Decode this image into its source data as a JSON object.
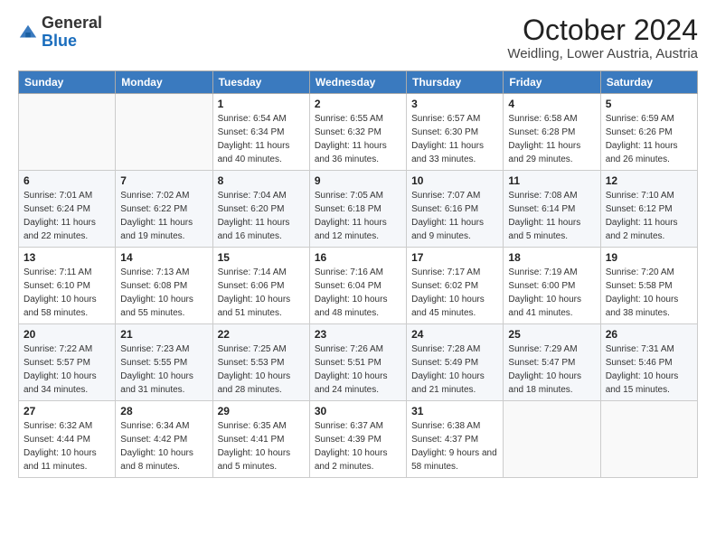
{
  "logo": {
    "general": "General",
    "blue": "Blue"
  },
  "header": {
    "month": "October 2024",
    "location": "Weidling, Lower Austria, Austria"
  },
  "weekdays": [
    "Sunday",
    "Monday",
    "Tuesday",
    "Wednesday",
    "Thursday",
    "Friday",
    "Saturday"
  ],
  "weeks": [
    [
      {
        "day": "",
        "sunrise": "",
        "sunset": "",
        "daylight": ""
      },
      {
        "day": "",
        "sunrise": "",
        "sunset": "",
        "daylight": ""
      },
      {
        "day": "1",
        "sunrise": "Sunrise: 6:54 AM",
        "sunset": "Sunset: 6:34 PM",
        "daylight": "Daylight: 11 hours and 40 minutes."
      },
      {
        "day": "2",
        "sunrise": "Sunrise: 6:55 AM",
        "sunset": "Sunset: 6:32 PM",
        "daylight": "Daylight: 11 hours and 36 minutes."
      },
      {
        "day": "3",
        "sunrise": "Sunrise: 6:57 AM",
        "sunset": "Sunset: 6:30 PM",
        "daylight": "Daylight: 11 hours and 33 minutes."
      },
      {
        "day": "4",
        "sunrise": "Sunrise: 6:58 AM",
        "sunset": "Sunset: 6:28 PM",
        "daylight": "Daylight: 11 hours and 29 minutes."
      },
      {
        "day": "5",
        "sunrise": "Sunrise: 6:59 AM",
        "sunset": "Sunset: 6:26 PM",
        "daylight": "Daylight: 11 hours and 26 minutes."
      }
    ],
    [
      {
        "day": "6",
        "sunrise": "Sunrise: 7:01 AM",
        "sunset": "Sunset: 6:24 PM",
        "daylight": "Daylight: 11 hours and 22 minutes."
      },
      {
        "day": "7",
        "sunrise": "Sunrise: 7:02 AM",
        "sunset": "Sunset: 6:22 PM",
        "daylight": "Daylight: 11 hours and 19 minutes."
      },
      {
        "day": "8",
        "sunrise": "Sunrise: 7:04 AM",
        "sunset": "Sunset: 6:20 PM",
        "daylight": "Daylight: 11 hours and 16 minutes."
      },
      {
        "day": "9",
        "sunrise": "Sunrise: 7:05 AM",
        "sunset": "Sunset: 6:18 PM",
        "daylight": "Daylight: 11 hours and 12 minutes."
      },
      {
        "day": "10",
        "sunrise": "Sunrise: 7:07 AM",
        "sunset": "Sunset: 6:16 PM",
        "daylight": "Daylight: 11 hours and 9 minutes."
      },
      {
        "day": "11",
        "sunrise": "Sunrise: 7:08 AM",
        "sunset": "Sunset: 6:14 PM",
        "daylight": "Daylight: 11 hours and 5 minutes."
      },
      {
        "day": "12",
        "sunrise": "Sunrise: 7:10 AM",
        "sunset": "Sunset: 6:12 PM",
        "daylight": "Daylight: 11 hours and 2 minutes."
      }
    ],
    [
      {
        "day": "13",
        "sunrise": "Sunrise: 7:11 AM",
        "sunset": "Sunset: 6:10 PM",
        "daylight": "Daylight: 10 hours and 58 minutes."
      },
      {
        "day": "14",
        "sunrise": "Sunrise: 7:13 AM",
        "sunset": "Sunset: 6:08 PM",
        "daylight": "Daylight: 10 hours and 55 minutes."
      },
      {
        "day": "15",
        "sunrise": "Sunrise: 7:14 AM",
        "sunset": "Sunset: 6:06 PM",
        "daylight": "Daylight: 10 hours and 51 minutes."
      },
      {
        "day": "16",
        "sunrise": "Sunrise: 7:16 AM",
        "sunset": "Sunset: 6:04 PM",
        "daylight": "Daylight: 10 hours and 48 minutes."
      },
      {
        "day": "17",
        "sunrise": "Sunrise: 7:17 AM",
        "sunset": "Sunset: 6:02 PM",
        "daylight": "Daylight: 10 hours and 45 minutes."
      },
      {
        "day": "18",
        "sunrise": "Sunrise: 7:19 AM",
        "sunset": "Sunset: 6:00 PM",
        "daylight": "Daylight: 10 hours and 41 minutes."
      },
      {
        "day": "19",
        "sunrise": "Sunrise: 7:20 AM",
        "sunset": "Sunset: 5:58 PM",
        "daylight": "Daylight: 10 hours and 38 minutes."
      }
    ],
    [
      {
        "day": "20",
        "sunrise": "Sunrise: 7:22 AM",
        "sunset": "Sunset: 5:57 PM",
        "daylight": "Daylight: 10 hours and 34 minutes."
      },
      {
        "day": "21",
        "sunrise": "Sunrise: 7:23 AM",
        "sunset": "Sunset: 5:55 PM",
        "daylight": "Daylight: 10 hours and 31 minutes."
      },
      {
        "day": "22",
        "sunrise": "Sunrise: 7:25 AM",
        "sunset": "Sunset: 5:53 PM",
        "daylight": "Daylight: 10 hours and 28 minutes."
      },
      {
        "day": "23",
        "sunrise": "Sunrise: 7:26 AM",
        "sunset": "Sunset: 5:51 PM",
        "daylight": "Daylight: 10 hours and 24 minutes."
      },
      {
        "day": "24",
        "sunrise": "Sunrise: 7:28 AM",
        "sunset": "Sunset: 5:49 PM",
        "daylight": "Daylight: 10 hours and 21 minutes."
      },
      {
        "day": "25",
        "sunrise": "Sunrise: 7:29 AM",
        "sunset": "Sunset: 5:47 PM",
        "daylight": "Daylight: 10 hours and 18 minutes."
      },
      {
        "day": "26",
        "sunrise": "Sunrise: 7:31 AM",
        "sunset": "Sunset: 5:46 PM",
        "daylight": "Daylight: 10 hours and 15 minutes."
      }
    ],
    [
      {
        "day": "27",
        "sunrise": "Sunrise: 6:32 AM",
        "sunset": "Sunset: 4:44 PM",
        "daylight": "Daylight: 10 hours and 11 minutes."
      },
      {
        "day": "28",
        "sunrise": "Sunrise: 6:34 AM",
        "sunset": "Sunset: 4:42 PM",
        "daylight": "Daylight: 10 hours and 8 minutes."
      },
      {
        "day": "29",
        "sunrise": "Sunrise: 6:35 AM",
        "sunset": "Sunset: 4:41 PM",
        "daylight": "Daylight: 10 hours and 5 minutes."
      },
      {
        "day": "30",
        "sunrise": "Sunrise: 6:37 AM",
        "sunset": "Sunset: 4:39 PM",
        "daylight": "Daylight: 10 hours and 2 minutes."
      },
      {
        "day": "31",
        "sunrise": "Sunrise: 6:38 AM",
        "sunset": "Sunset: 4:37 PM",
        "daylight": "Daylight: 9 hours and 58 minutes."
      },
      {
        "day": "",
        "sunrise": "",
        "sunset": "",
        "daylight": ""
      },
      {
        "day": "",
        "sunrise": "",
        "sunset": "",
        "daylight": ""
      }
    ]
  ]
}
